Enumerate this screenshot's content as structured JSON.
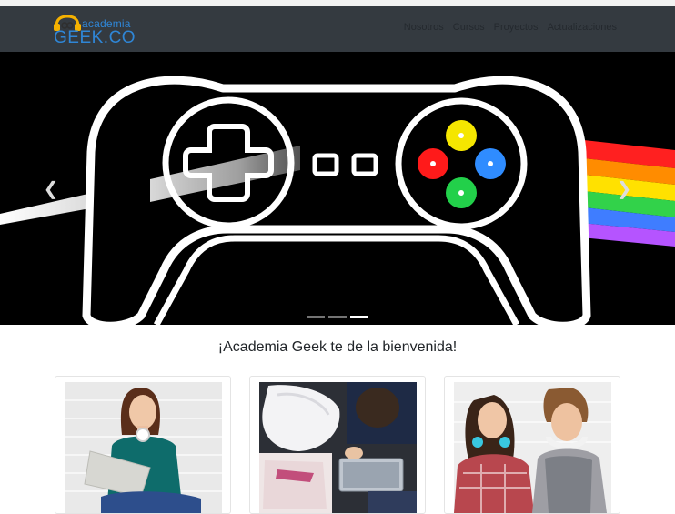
{
  "navbar": {
    "brand": {
      "top": "academia",
      "main": "GEEK.CO"
    },
    "links": [
      "Nosotros",
      "Cursos",
      "Proyectos",
      "Actualizaciones"
    ]
  },
  "carousel": {
    "prev_icon": "chevron-left-icon",
    "next_icon": "chevron-right-icon",
    "slide_count": 3,
    "active_slide": 3
  },
  "main": {
    "welcome": "¡Academia Geek te de la bienvenida!"
  },
  "cards": [
    {
      "image": "girl-with-laptop"
    },
    {
      "image": "students-studying-top-view"
    },
    {
      "image": "two-students-with-headphones"
    }
  ],
  "colors": {
    "navbar": "#343a40",
    "brand": "#2f86d6",
    "logo_headphones": "#f5b100"
  }
}
